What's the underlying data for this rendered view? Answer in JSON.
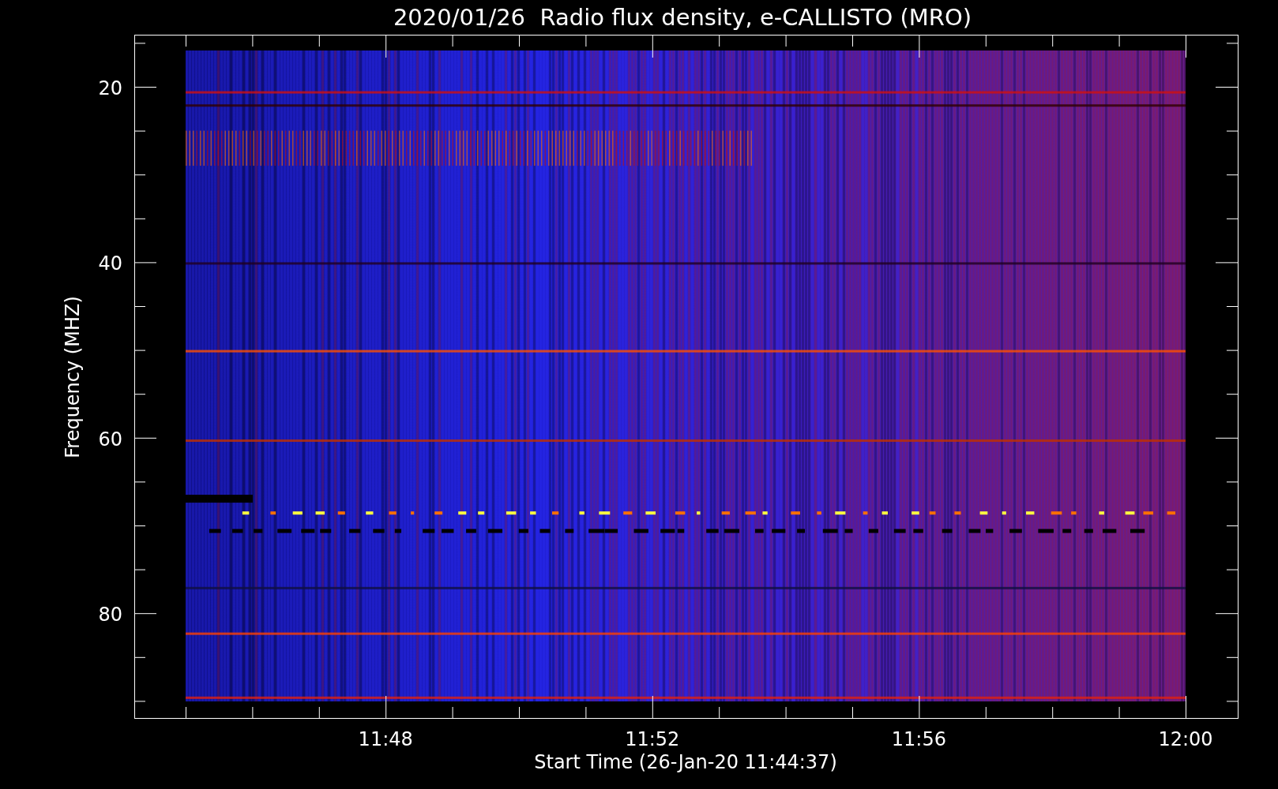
{
  "title": "2020/01/26  Radio flux density, e-CALLISTO (MRO)",
  "y_axis": {
    "label": "Frequency (MHZ)",
    "ticks": [
      "20",
      "40",
      "60",
      "80"
    ]
  },
  "x_axis": {
    "label": "Start Time (26-Jan-20 11:44:37)",
    "ticks": [
      "11:48",
      "11:52",
      "11:56",
      "12:00"
    ]
  }
}
